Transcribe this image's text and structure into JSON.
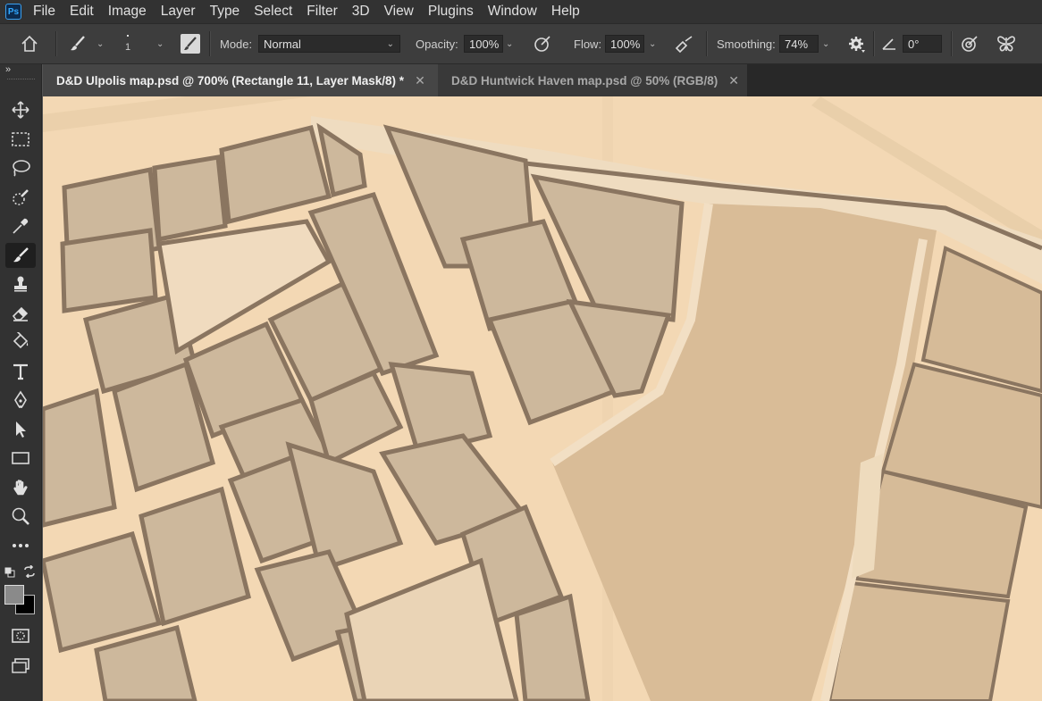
{
  "app": {
    "logo_text": "Ps"
  },
  "menu": [
    "File",
    "Edit",
    "Image",
    "Layer",
    "Type",
    "Select",
    "Filter",
    "3D",
    "View",
    "Plugins",
    "Window",
    "Help"
  ],
  "options": {
    "brush_size": "1",
    "mode_label": "Mode:",
    "mode_value": "Normal",
    "opacity_label": "Opacity:",
    "opacity_value": "100%",
    "flow_label": "Flow:",
    "flow_value": "100%",
    "smoothing_label": "Smoothing:",
    "smoothing_value": "74%",
    "angle_value": "0°"
  },
  "tabs": [
    {
      "title": "D&D Ulpolis map.psd @ 700% (Rectangle 11, Layer Mask/8) *",
      "active": true
    },
    {
      "title": "D&D Huntwick Haven map.psd @ 50% (RGB/8)",
      "active": false
    }
  ],
  "tools": [
    {
      "name": "move-tool",
      "icon": "move-icon"
    },
    {
      "name": "marquee-tool",
      "icon": "rect-marquee-icon"
    },
    {
      "name": "lasso-tool",
      "icon": "lasso-icon"
    },
    {
      "name": "quick-selection-tool",
      "icon": "quick-select-icon"
    },
    {
      "name": "eyedropper-tool",
      "icon": "eyedropper-icon"
    },
    {
      "name": "brush-tool",
      "icon": "brush-icon",
      "active": true
    },
    {
      "name": "stamp-tool",
      "icon": "stamp-icon"
    },
    {
      "name": "eraser-tool",
      "icon": "eraser-icon"
    },
    {
      "name": "paint-bucket-tool",
      "icon": "bucket-icon"
    },
    {
      "name": "type-tool",
      "icon": "type-icon"
    },
    {
      "name": "pen-tool",
      "icon": "pen-icon"
    },
    {
      "name": "path-selection-tool",
      "icon": "arrow-icon"
    },
    {
      "name": "rectangle-tool",
      "icon": "rectangle-icon"
    },
    {
      "name": "hand-tool",
      "icon": "hand-icon"
    },
    {
      "name": "zoom-tool",
      "icon": "zoom-icon"
    },
    {
      "name": "more-tools",
      "icon": "more-icon"
    }
  ],
  "colors": {
    "foreground": "#8a8a8a",
    "background": "#000000",
    "canvas_light": "#f2d7b2",
    "canvas_block": "#cdb89c",
    "canvas_outline": "#8a7560"
  }
}
